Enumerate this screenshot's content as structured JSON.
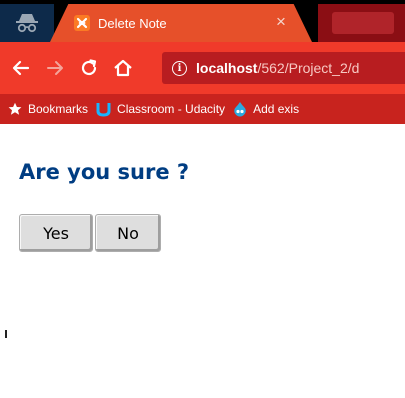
{
  "browser": {
    "tab": {
      "title": "Delete Note",
      "close_glyph": "×",
      "favicon": "xampp-icon"
    },
    "address": {
      "host": "localhost",
      "path": "/562/Project_2/d"
    },
    "bookmarks": [
      {
        "label": "Bookmarks",
        "icon": "star-icon"
      },
      {
        "label": "Classroom - Udacity",
        "icon": "udacity-icon"
      },
      {
        "label": "Add exis",
        "icon": "drupal-icon"
      }
    ],
    "colors": {
      "tab": "#e6502a",
      "toolbar": "#f03a2a",
      "bookmarks_bar": "#c8231e",
      "heading": "#003d82"
    }
  },
  "page": {
    "heading": "Are you sure ?",
    "buttons": {
      "yes": "Yes",
      "no": "No"
    }
  }
}
